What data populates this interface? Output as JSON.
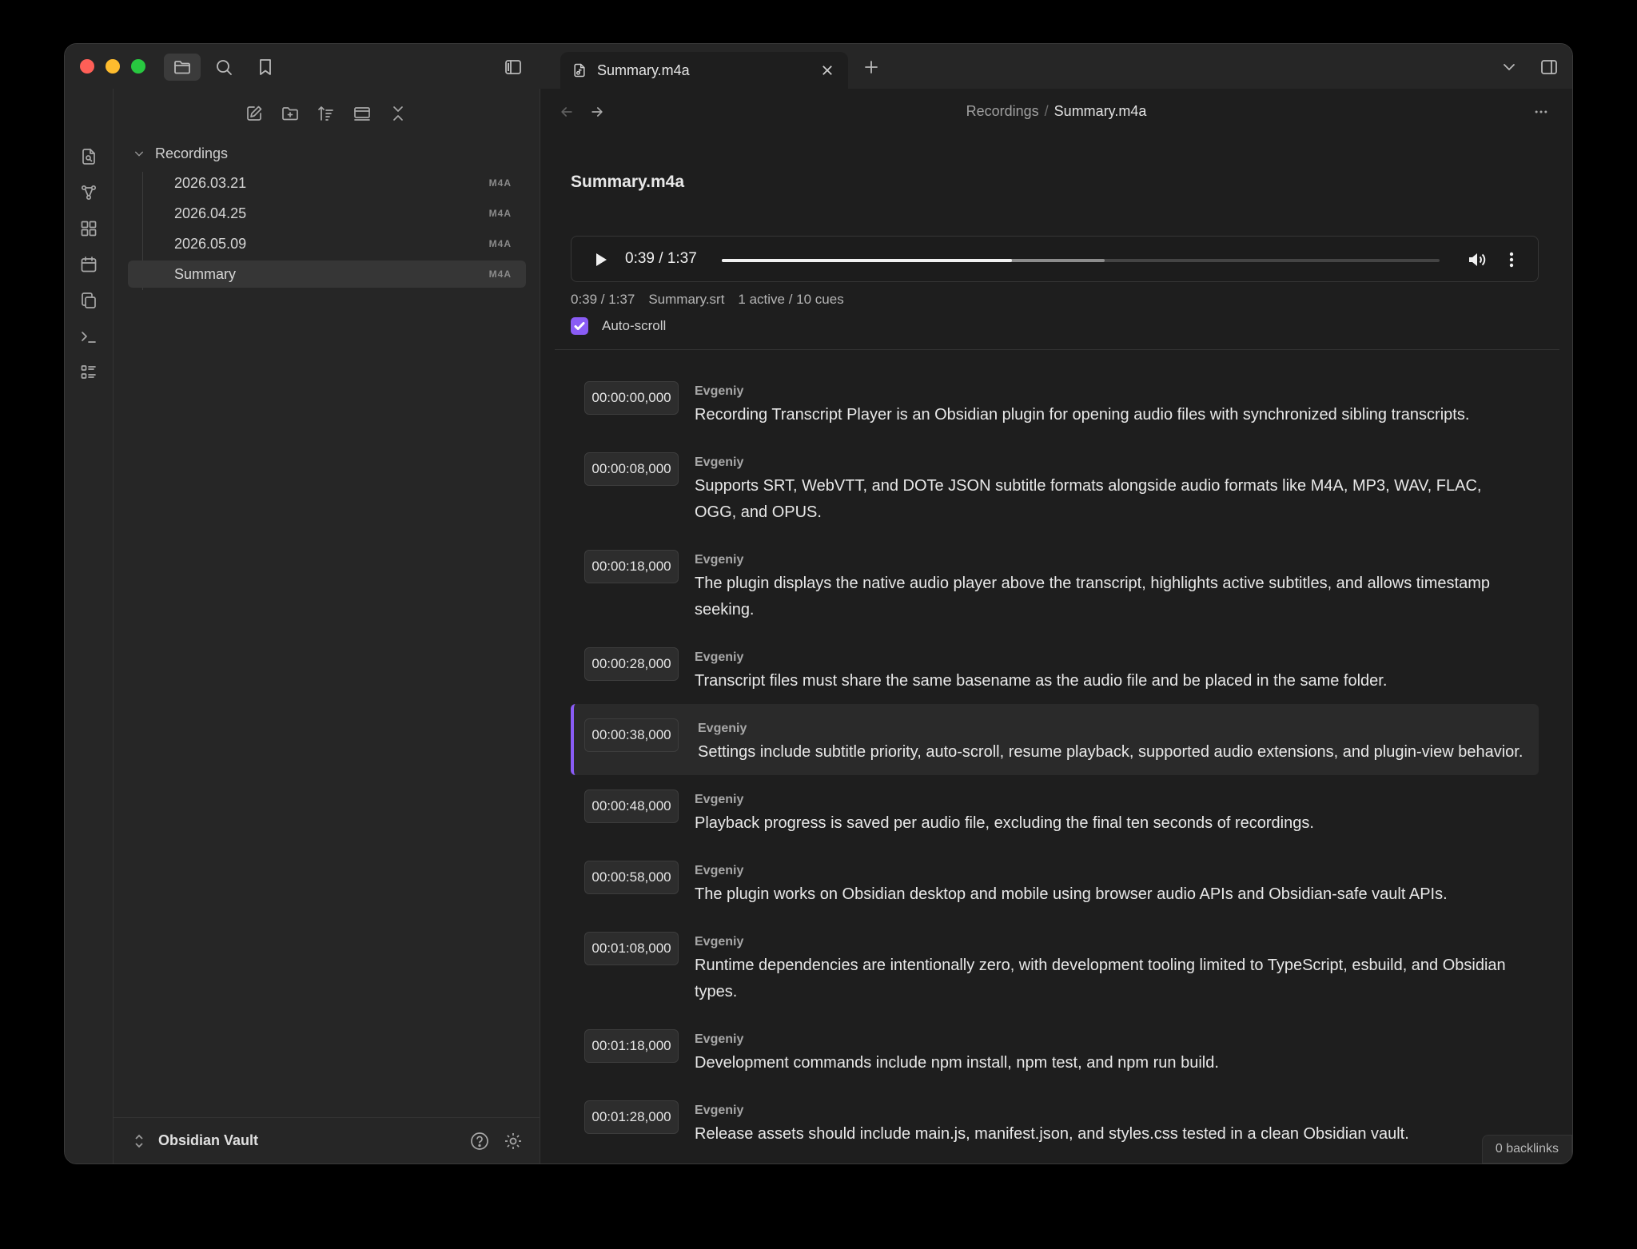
{
  "window": {
    "tab_title": "Summary.m4a"
  },
  "sidebar": {
    "folder": "Recordings",
    "files": [
      {
        "name": "2026.03.21",
        "ext": "M4A",
        "active": false
      },
      {
        "name": "2026.04.25",
        "ext": "M4A",
        "active": false
      },
      {
        "name": "2026.05.09",
        "ext": "M4A",
        "active": false
      },
      {
        "name": "Summary",
        "ext": "M4A",
        "active": true
      }
    ],
    "vault_name": "Obsidian Vault"
  },
  "main": {
    "breadcrumb": {
      "folder": "Recordings",
      "separator": "/",
      "file": "Summary.m4a"
    },
    "note_title": "Summary.m4a",
    "player": {
      "time": "0:39 / 1:37",
      "progress_fraction": 0.404,
      "buffered_fraction": 0.533
    },
    "status": {
      "time": "0:39 / 1:37",
      "subtitle_file": "Summary.srt",
      "cues": "1 active / 10 cues"
    },
    "autoscroll": {
      "label": "Auto-scroll",
      "checked": true
    },
    "cues": [
      {
        "time": "00:00:00,000",
        "speaker": "Evgeniy",
        "text": "Recording Transcript Player is an Obsidian plugin for opening audio files with synchronized sibling transcripts.",
        "active": false
      },
      {
        "time": "00:00:08,000",
        "speaker": "Evgeniy",
        "text": "Supports SRT, WebVTT, and DOTe JSON subtitle formats alongside audio formats like M4A, MP3, WAV, FLAC, OGG, and OPUS.",
        "active": false
      },
      {
        "time": "00:00:18,000",
        "speaker": "Evgeniy",
        "text": "The plugin displays the native audio player above the transcript, highlights active subtitles, and allows timestamp seeking.",
        "active": false
      },
      {
        "time": "00:00:28,000",
        "speaker": "Evgeniy",
        "text": "Transcript files must share the same basename as the audio file and be placed in the same folder.",
        "active": false
      },
      {
        "time": "00:00:38,000",
        "speaker": "Evgeniy",
        "text": "Settings include subtitle priority, auto-scroll, resume playback, supported audio extensions, and plugin-view behavior.",
        "active": true
      },
      {
        "time": "00:00:48,000",
        "speaker": "Evgeniy",
        "text": "Playback progress is saved per audio file, excluding the final ten seconds of recordings.",
        "active": false
      },
      {
        "time": "00:00:58,000",
        "speaker": "Evgeniy",
        "text": "The plugin works on Obsidian desktop and mobile using browser audio APIs and Obsidian-safe vault APIs.",
        "active": false
      },
      {
        "time": "00:01:08,000",
        "speaker": "Evgeniy",
        "text": "Runtime dependencies are intentionally zero, with development tooling limited to TypeScript, esbuild, and Obsidian types.",
        "active": false
      },
      {
        "time": "00:01:18,000",
        "speaker": "Evgeniy",
        "text": "Development commands include npm install, npm test, and npm run build.",
        "active": false
      },
      {
        "time": "00:01:28,000",
        "speaker": "Evgeniy",
        "text": "Release assets should include main.js, manifest.json, and styles.css tested in a clean Obsidian vault.",
        "active": false
      }
    ],
    "backlinks": "0 backlinks"
  },
  "colors": {
    "accent": "#8a5cf5",
    "background": "#1e1e1e",
    "sidebar": "#262626"
  },
  "icons": {
    "titlebar": [
      "folder-icon",
      "search-icon",
      "bookmark-icon",
      "sidebar-toggle-icon"
    ],
    "ribbon": [
      "search-file-icon",
      "graph-icon",
      "canvas-icon",
      "calendar-icon",
      "copy-icon",
      "terminal-icon",
      "list-icon"
    ],
    "sidebar_toolbar": [
      "new-note-icon",
      "new-folder-icon",
      "sort-icon",
      "collapse-view-icon",
      "collapse-all-icon"
    ]
  }
}
